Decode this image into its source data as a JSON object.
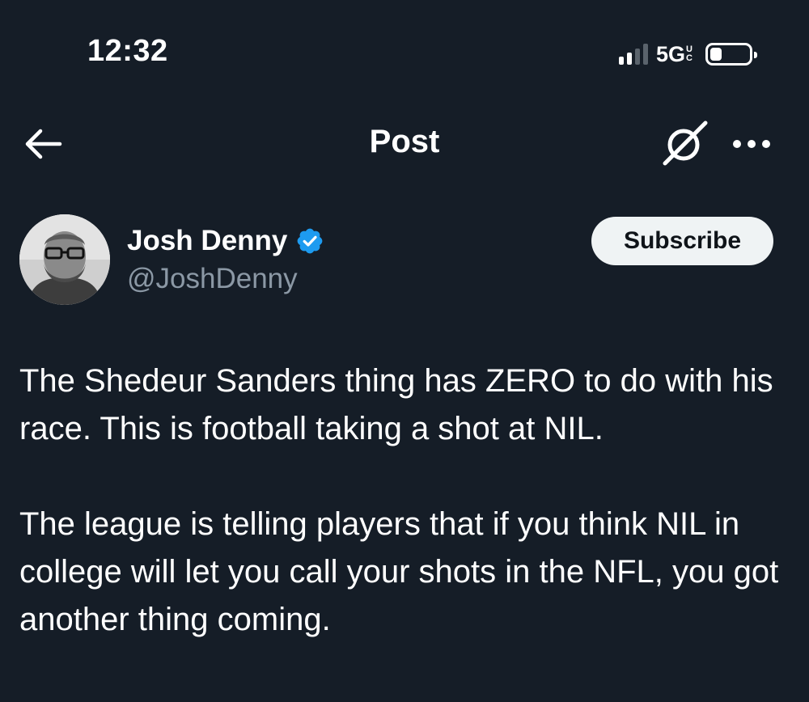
{
  "status_bar": {
    "time": "12:32",
    "network": "5G",
    "network_sub_top": "U",
    "network_sub_bottom": "C",
    "signal_bars": 4,
    "signal_bars_active": 2,
    "battery_level": 0.3
  },
  "header": {
    "title": "Post",
    "back_icon": "arrow-left-icon",
    "grok_icon": "grok-icon",
    "more_icon": "more-horizontal-icon"
  },
  "author": {
    "name": "Josh Denny",
    "handle": "@JoshDenny",
    "verified": true,
    "verified_color": "#1d9bf0",
    "subscribe_label": "Subscribe"
  },
  "post": {
    "paragraph_1": "The Shedeur Sanders thing has ZERO to do with his race. This is football taking a shot at NIL.",
    "paragraph_2": "The league is telling players that if you think NIL in college will let you call your shots in the NFL, you got another thing coming."
  },
  "colors": {
    "background": "#151d27",
    "text_primary": "#ffffff",
    "text_secondary": "#8b98a5",
    "button_bg": "#eff3f4"
  }
}
